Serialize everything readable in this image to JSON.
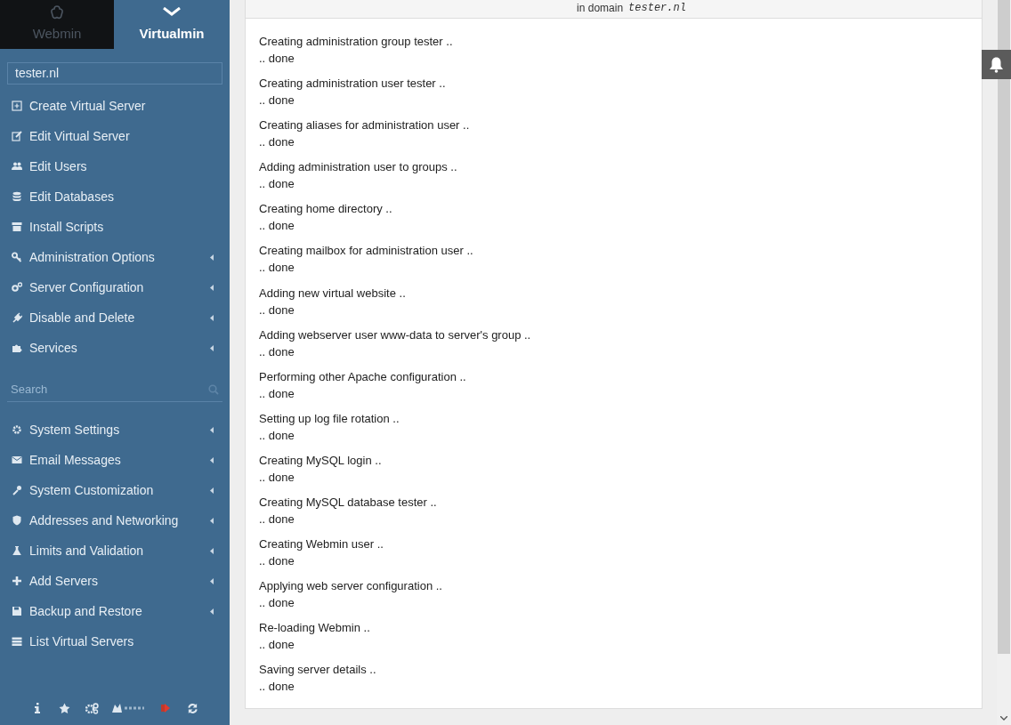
{
  "switcher": [
    {
      "label": "Webmin",
      "selected": false
    },
    {
      "label": "Virtualmin",
      "selected": true
    }
  ],
  "domain_select": {
    "value": "tester.nl"
  },
  "menu_top": [
    {
      "label": "Create Virtual Server",
      "submenu": false
    },
    {
      "label": "Edit Virtual Server",
      "submenu": false
    },
    {
      "label": "Edit Users",
      "submenu": false
    },
    {
      "label": "Edit Databases",
      "submenu": false
    },
    {
      "label": "Install Scripts",
      "submenu": false
    },
    {
      "label": "Administration Options",
      "submenu": true
    },
    {
      "label": "Server Configuration",
      "submenu": true
    },
    {
      "label": "Disable and Delete",
      "submenu": true
    },
    {
      "label": "Services",
      "submenu": true
    }
  ],
  "search": {
    "placeholder": "Search"
  },
  "menu_bottom": [
    {
      "label": "System Settings",
      "submenu": true
    },
    {
      "label": "Email Messages",
      "submenu": true
    },
    {
      "label": "System Customization",
      "submenu": true
    },
    {
      "label": "Addresses and Networking",
      "submenu": true
    },
    {
      "label": "Limits and Validation",
      "submenu": true
    },
    {
      "label": "Add Servers",
      "submenu": true
    },
    {
      "label": "Backup and Restore",
      "submenu": true
    },
    {
      "label": "List Virtual Servers",
      "submenu": false
    }
  ],
  "header": {
    "text": "in domain",
    "domain": "tester.nl"
  },
  "steps": [
    {
      "text": "Creating administration group tester ..",
      "result": ".. done"
    },
    {
      "text": "Creating administration user tester ..",
      "result": ".. done"
    },
    {
      "text": "Creating aliases for administration user ..",
      "result": ".. done"
    },
    {
      "text": "Adding administration user to groups ..",
      "result": ".. done"
    },
    {
      "text": "Creating home directory ..",
      "result": ".. done"
    },
    {
      "text": "Creating mailbox for administration user ..",
      "result": ".. done"
    },
    {
      "text": "Adding new virtual website ..",
      "result": ".. done"
    },
    {
      "text": "Adding webserver user www-data to server's group ..",
      "result": ".. done"
    },
    {
      "text": "Performing other Apache configuration ..",
      "result": ".. done"
    },
    {
      "text": "Setting up log file rotation ..",
      "result": ".. done"
    },
    {
      "text": "Creating MySQL login ..",
      "result": ".. done"
    },
    {
      "text": "Creating MySQL database tester ..",
      "result": ".. done"
    },
    {
      "text": "Creating Webmin user ..",
      "result": ".. done"
    },
    {
      "text": "Applying web server configuration ..",
      "result": ".. done"
    },
    {
      "text": "Re-loading Webmin ..",
      "result": ".. done"
    },
    {
      "text": "Saving server details ..",
      "result": ".. done"
    }
  ]
}
